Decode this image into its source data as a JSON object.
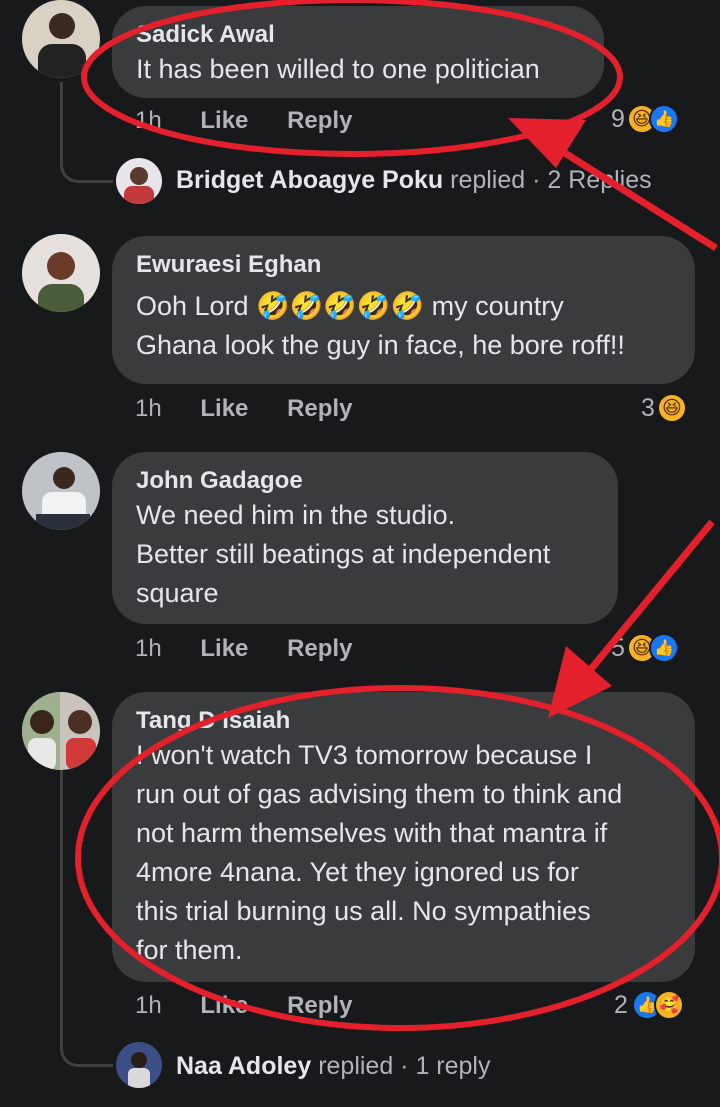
{
  "comments": [
    {
      "author": "Sadick Awal",
      "text": "It has been willed to one politician",
      "time": "1h",
      "like": "Like",
      "reply": "Reply",
      "reaction_count": "9",
      "replied": {
        "name": "Bridget Aboagye Poku",
        "suffix": "replied · 2 Replies"
      }
    },
    {
      "author": "Ewuraesi Eghan",
      "text": "Ooh Lord 🤣🤣🤣🤣🤣 my country\nGhana look the guy in face, he bore roff!!",
      "time": "1h",
      "like": "Like",
      "reply": "Reply",
      "reaction_count": "3"
    },
    {
      "author": "John Gadagoe",
      "text": "We need him in the studio.\nBetter still beatings at independent\nsquare",
      "time": "1h",
      "like": "Like",
      "reply": "Reply",
      "reaction_count": "5"
    },
    {
      "author": "Tang D Isaiah",
      "text": "I won't watch TV3 tomorrow because I\nrun out of gas advising them to think and\nnot harm themselves with that mantra if\n4more 4nana. Yet they ignored us for\nthis trial burning us all. No sympathies\nfor them.",
      "time": "1h",
      "like": "Like",
      "reply": "Reply",
      "reaction_count": "2",
      "replied": {
        "name": "Naa Adoley",
        "suffix": "replied · 1 reply"
      }
    }
  ],
  "icons": {
    "haha": "😆",
    "like": "👍",
    "care": "🥰"
  },
  "colors": {
    "background": "#18191a",
    "bubble": "#3a3b3c",
    "annotation": "#e3202b",
    "like_blue": "#1877f2",
    "haha_yellow": "#f7b125"
  }
}
